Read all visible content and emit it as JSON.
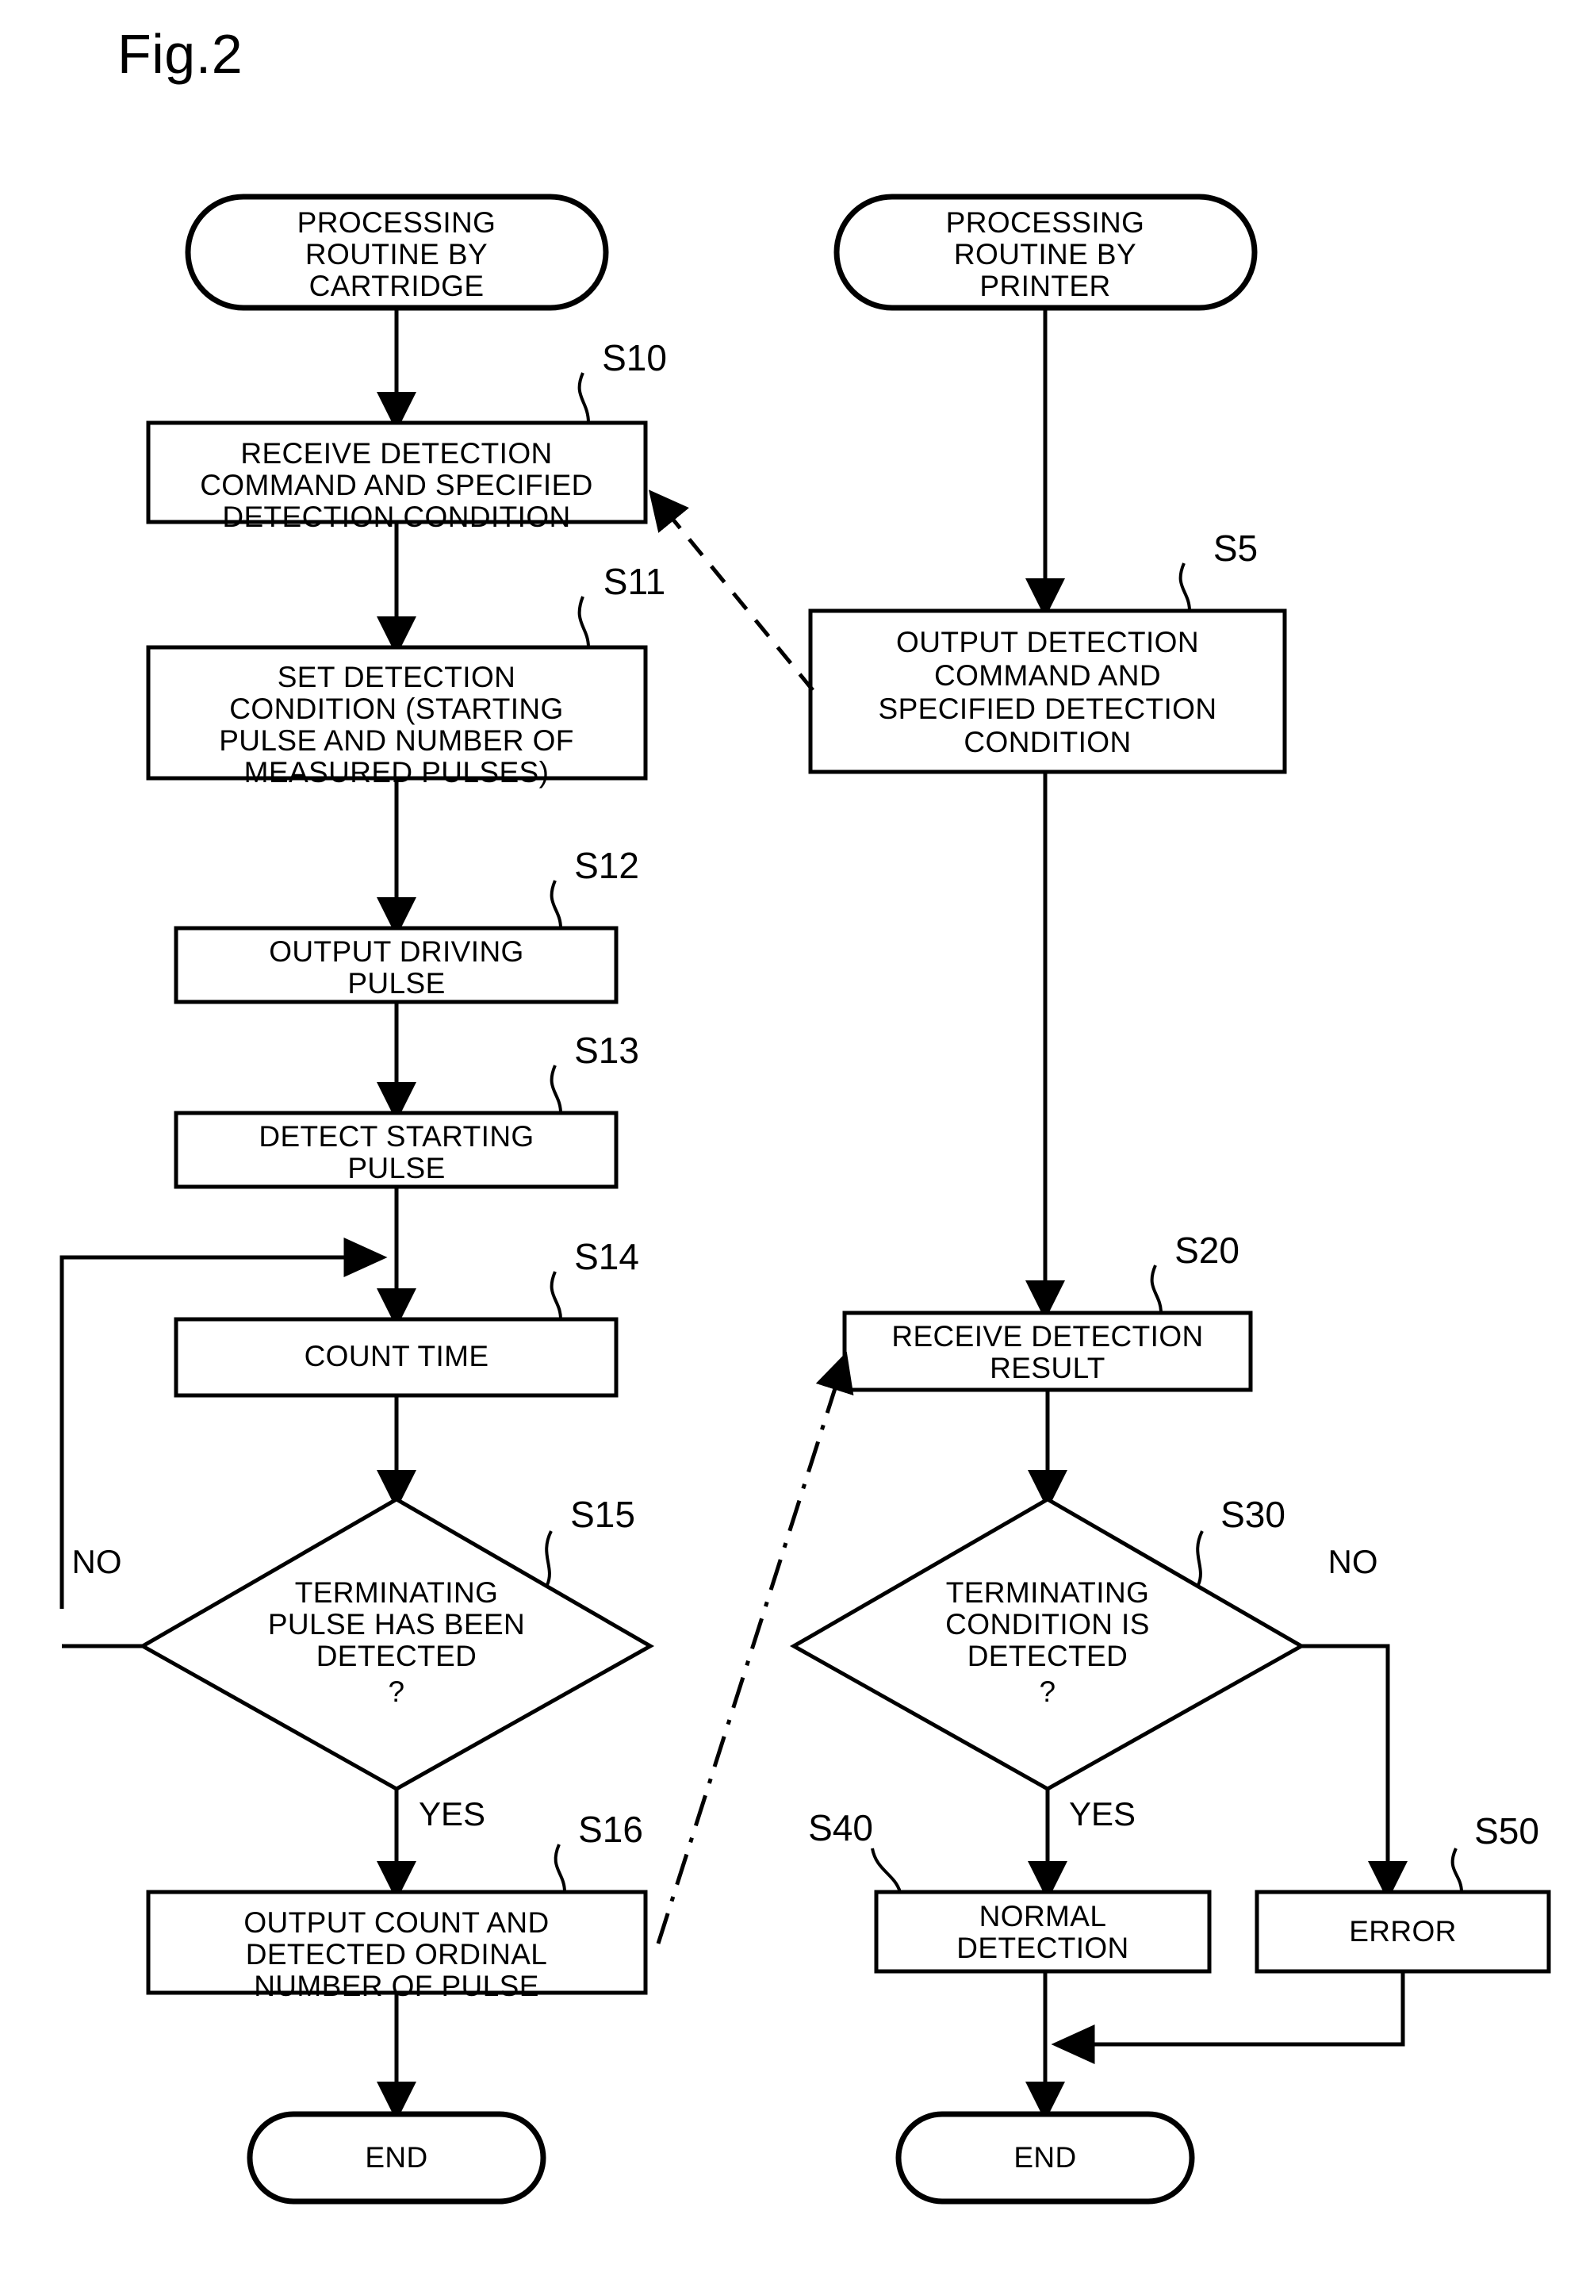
{
  "figure": {
    "label": "Fig.2"
  },
  "nodes": {
    "start_cartridge": {
      "id": "start-cartridge",
      "type": "terminator",
      "lines": [
        "PROCESSING",
        "ROUTINE BY",
        "CARTRIDGE"
      ]
    },
    "start_printer": {
      "id": "start-printer",
      "type": "terminator",
      "lines": [
        "PROCESSING",
        "ROUTINE BY",
        "PRINTER"
      ]
    },
    "s10": {
      "step": "S10",
      "type": "process",
      "lines": [
        "RECEIVE DETECTION",
        "COMMAND AND SPECIFIED",
        "DETECTION CONDITION"
      ]
    },
    "s11": {
      "step": "S11",
      "type": "process",
      "lines": [
        "SET DETECTION",
        "CONDITION (STARTING",
        "PULSE AND NUMBER OF",
        "MEASURED PULSES)"
      ]
    },
    "s12": {
      "step": "S12",
      "type": "process",
      "lines": [
        "OUTPUT DRIVING",
        "PULSE"
      ]
    },
    "s13": {
      "step": "S13",
      "type": "process",
      "lines": [
        "DETECT STARTING",
        "PULSE"
      ]
    },
    "s14": {
      "step": "S14",
      "type": "process",
      "lines": [
        "COUNT TIME"
      ]
    },
    "s15": {
      "step": "S15",
      "type": "decision",
      "lines": [
        "TERMINATING",
        "PULSE HAS BEEN",
        "DETECTED",
        "?"
      ],
      "branch_no": "NO",
      "branch_yes": "YES"
    },
    "s16": {
      "step": "S16",
      "type": "process",
      "lines": [
        "OUTPUT COUNT AND",
        "DETECTED ORDINAL",
        "NUMBER OF PULSE"
      ]
    },
    "s5": {
      "step": "S5",
      "type": "process",
      "lines": [
        "OUTPUT DETECTION",
        "COMMAND AND",
        "SPECIFIED DETECTION",
        "CONDITION"
      ]
    },
    "s20": {
      "step": "S20",
      "type": "process",
      "lines": [
        "RECEIVE DETECTION",
        "RESULT"
      ]
    },
    "s30": {
      "step": "S30",
      "type": "decision",
      "lines": [
        "TERMINATING",
        "CONDITION IS",
        "DETECTED",
        "?"
      ],
      "branch_no": "NO",
      "branch_yes": "YES"
    },
    "s40": {
      "step": "S40",
      "type": "process",
      "lines": [
        "NORMAL",
        "DETECTION"
      ]
    },
    "s50": {
      "step": "S50",
      "type": "process",
      "lines": [
        "ERROR"
      ]
    },
    "end_cartridge": {
      "id": "end-cartridge",
      "type": "terminator",
      "lines": [
        "END"
      ]
    },
    "end_printer": {
      "id": "end-printer",
      "type": "terminator",
      "lines": [
        "END"
      ]
    }
  },
  "colors": {
    "stroke": "#000000",
    "fill": "#ffffff",
    "background": "#ffffff"
  }
}
